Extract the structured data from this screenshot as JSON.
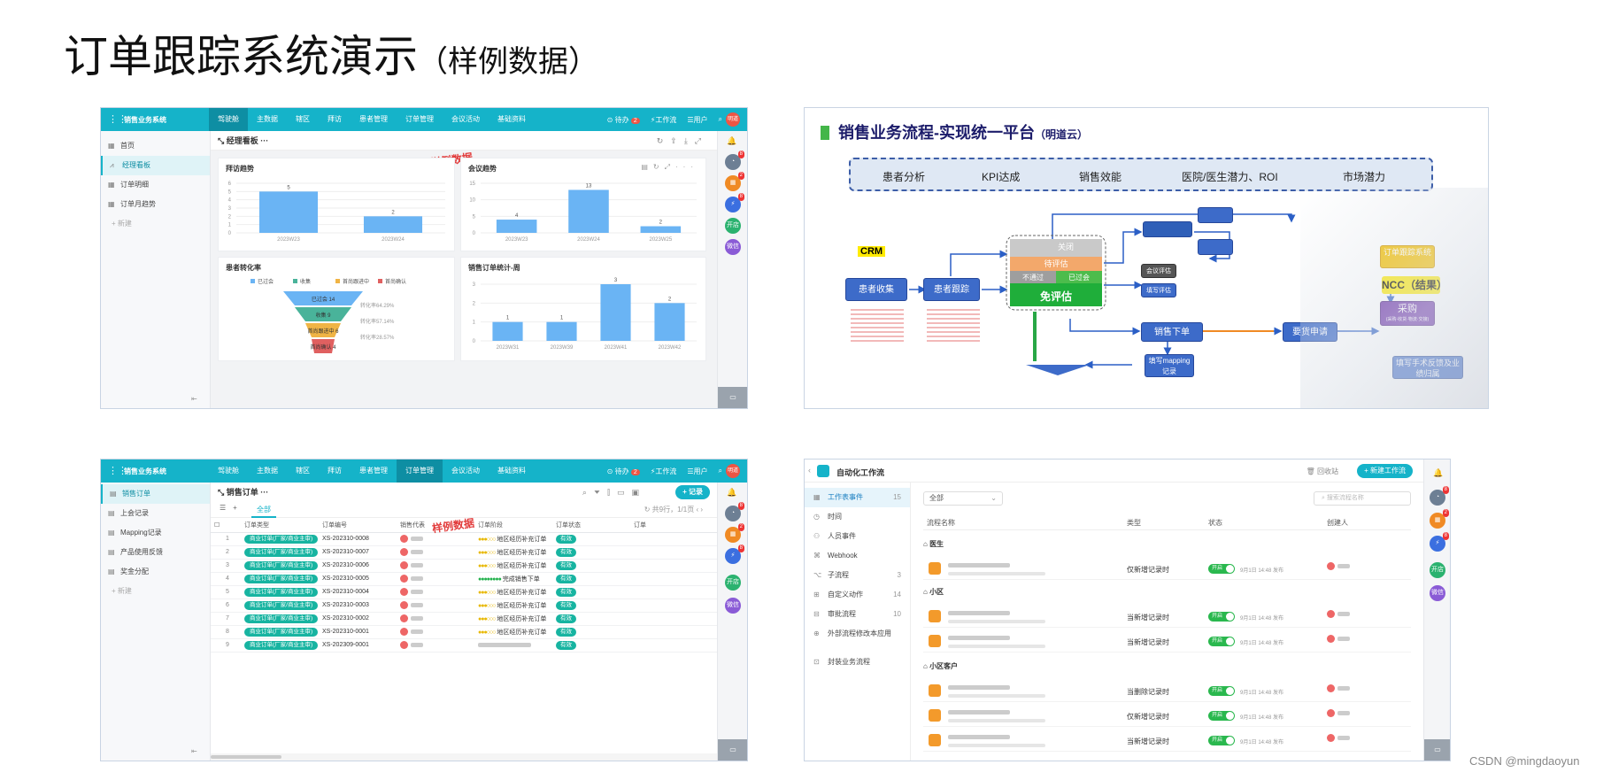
{
  "page": {
    "title": "订单跟踪系统演示",
    "subtitle": "（样例数据）",
    "credit": "CSDN @mingdaoyun"
  },
  "watermark": "样例数据",
  "crm": {
    "app_name": "销售业务系统",
    "nav": [
      "驾驶舱",
      "主数据",
      "辖区",
      "拜访",
      "患者管理",
      "订单管理",
      "会议活动",
      "基础资料"
    ],
    "todo_label": "待办",
    "todo_count": "2",
    "workflow_label": "工作流",
    "user_label": "用户",
    "avatar_text": "明道",
    "rightbar_badges": [
      "8",
      "2",
      "8"
    ],
    "rightbar_labels": [
      "开店",
      "微信"
    ]
  },
  "dashboard": {
    "sidebar": [
      {
        "label": "首页",
        "icon": "grid-icon"
      },
      {
        "label": "经理看板",
        "icon": "chart-icon",
        "active": true
      },
      {
        "label": "订单明细",
        "icon": "grid-icon"
      },
      {
        "label": "订单月趋势",
        "icon": "grid-icon"
      }
    ],
    "add_label": "+ 新建",
    "page_title": "经理看板",
    "charts": {
      "visit": {
        "title": "拜访趋势",
        "categories": [
          "2023W23",
          "2023W24"
        ],
        "values": [
          5,
          2
        ],
        "yticks": [
          "0",
          "1",
          "2",
          "3",
          "4",
          "5",
          "6"
        ]
      },
      "meeting": {
        "title": "会议趋势",
        "categories": [
          "2023W23",
          "2023W24",
          "2023W25"
        ],
        "values": [
          4,
          13,
          2
        ],
        "yticks": [
          "0",
          "5",
          "10",
          "15"
        ]
      },
      "funnel": {
        "title": "患者转化率",
        "legend": [
          "已过会",
          "收集",
          "首尚跟进中",
          "首尚确认"
        ],
        "stages": [
          "已过会 14",
          "收集 9",
          "首尚跟进中 6",
          "首尚确认 4"
        ],
        "rates": [
          "转化率64.29%",
          "转化率57.14%",
          "转化率28.57%"
        ]
      },
      "sales": {
        "title": "销售订单统计-周",
        "categories": [
          "2023W31",
          "2023W39",
          "2023W41",
          "2023W42"
        ],
        "values": [
          1,
          1,
          3,
          2
        ],
        "yticks": [
          "0",
          "1",
          "2",
          "3"
        ]
      }
    }
  },
  "process": {
    "title": "销售业务流程-实现统一平台",
    "title_note": "（明道云）",
    "kpis": [
      "患者分析",
      "KPI达成",
      "销售效能",
      "医院/医生潜力、ROI",
      "市场潜力"
    ],
    "crm_label": "CRM",
    "nodes": {
      "collect": "患者收集",
      "follow": "患者跟踪",
      "close": "关闭",
      "pending": "待评估",
      "fail": "不通过",
      "passed": "已过会",
      "free": "免评估",
      "order": "销售下单",
      "apply": "要货申请",
      "purchase": "采购",
      "purchase_note": "(采购·收货·物流·交接)",
      "ncc": "NCC（结果）",
      "tracking": "订单跟踪系统",
      "mapping_rec": "填写mapping记录",
      "feedback": "填写手术反馈及业绩归属",
      "meeting_eval": "会议评估",
      "fill_eval": "填写评估"
    }
  },
  "orders": {
    "sidebar": [
      "销售订单",
      "上会记录",
      "Mapping记录",
      "产品使用反馈",
      "奖金分配"
    ],
    "add_label": "+ 新建",
    "page_title": "销售订单",
    "tab_all": "全部",
    "record_btn": "+ 记录",
    "record_count": "共9行，1/1页",
    "columns": [
      "订单类型",
      "订单编号",
      "销售代表",
      "订单阶段",
      "订单状态",
      "订单"
    ],
    "rows": [
      {
        "n": "1",
        "type": "商业订单(厂家/商业主审)",
        "no": "XS-202310-0008",
        "stage": "地区经历补充订单",
        "status": "有效"
      },
      {
        "n": "2",
        "type": "商业订单(厂家/商业主审)",
        "no": "XS-202310-0007",
        "stage": "地区经历补充订单",
        "status": "有效"
      },
      {
        "n": "3",
        "type": "商业订单(厂家/商业主审)",
        "no": "XS-202310-0006",
        "stage": "地区经历补充订单",
        "status": "有效"
      },
      {
        "n": "4",
        "type": "商业订单(厂家/商业主审)",
        "no": "XS-202310-0005",
        "stage": "完成销售下单",
        "status": "有效"
      },
      {
        "n": "5",
        "type": "商业订单(厂家/商业主审)",
        "no": "XS-202310-0004",
        "stage": "地区经历补充订单",
        "status": "有效"
      },
      {
        "n": "6",
        "type": "商业订单(厂家/商业主审)",
        "no": "XS-202310-0003",
        "stage": "地区经历补充订单",
        "status": "有效"
      },
      {
        "n": "7",
        "type": "商业订单(厂家/商业主审)",
        "no": "XS-202310-0002",
        "stage": "地区经历补充订单",
        "status": "有效"
      },
      {
        "n": "8",
        "type": "商业订单(厂家/商业主审)",
        "no": "XS-202310-0001",
        "stage": "地区经历补充订单",
        "status": "有效"
      },
      {
        "n": "9",
        "type": "商业订单(厂家/商业主审)",
        "no": "XS-202309-0001",
        "stage": "",
        "status": "有效"
      }
    ]
  },
  "workflow": {
    "title": "自动化工作流",
    "recycle": "回收站",
    "new_btn": "+ 新建工作流",
    "side": [
      {
        "label": "工作表事件",
        "count": "15",
        "active": true
      },
      {
        "label": "时间",
        "count": ""
      },
      {
        "label": "人员事件",
        "count": ""
      },
      {
        "label": "Webhook",
        "count": ""
      },
      {
        "label": "子流程",
        "count": "3"
      },
      {
        "label": "自定义动作",
        "count": "14"
      },
      {
        "label": "审批流程",
        "count": "10"
      },
      {
        "label": "外部流程修改本应用",
        "count": ""
      },
      {
        "label": "封装业务流程",
        "count": ""
      }
    ],
    "filter": "全部",
    "search_placeholder": "搜索流程名称",
    "columns": [
      "流程名称",
      "类型",
      "状态",
      "创建人"
    ],
    "groups": [
      "医生",
      "小区",
      "小区客户"
    ],
    "rows": [
      {
        "type": "仅新增记录时",
        "status": "开启",
        "time": "9月1日 14:48 发布"
      },
      {
        "type": "当新增记录时",
        "status": "开启",
        "time": "9月1日 14:48 发布"
      },
      {
        "type": "当新增记录时",
        "status": "开启",
        "time": "9月1日 14:48 发布"
      },
      {
        "type": "当删除记录时",
        "status": "开启",
        "time": "9月1日 14:48 发布"
      },
      {
        "type": "仅新增记录时",
        "status": "开启",
        "time": "9月1日 14:48 发布"
      },
      {
        "type": "当新增记录时",
        "status": "开启",
        "time": "9月1日 14:48 发布"
      }
    ]
  },
  "colors": {
    "teal": "#15b3c9",
    "bar": "#6ab4f4",
    "green": "#17b4a1",
    "red": "#e23b3b"
  }
}
